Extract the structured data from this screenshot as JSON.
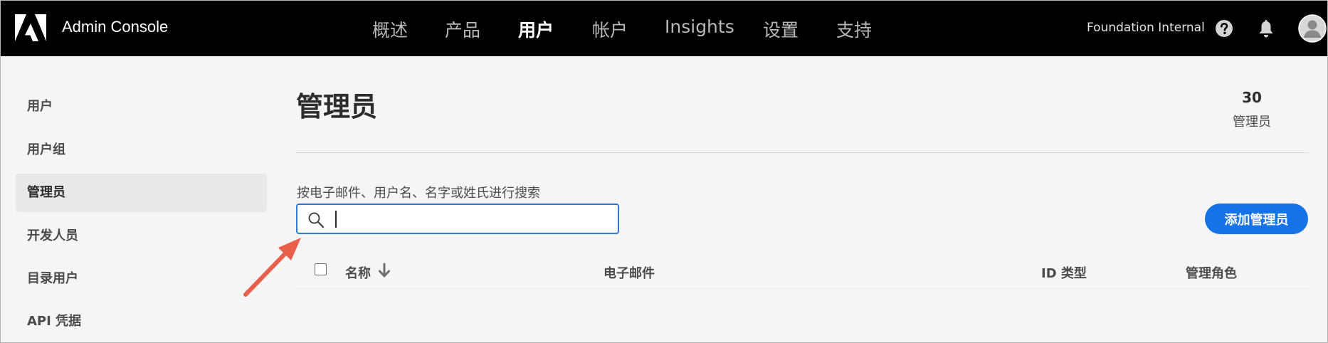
{
  "app": {
    "title": "Admin Console",
    "org_name": "Foundation Internal"
  },
  "nav": {
    "items": [
      {
        "label": "概述"
      },
      {
        "label": "产品"
      },
      {
        "label": "用户",
        "active": true
      },
      {
        "label": "帐户"
      },
      {
        "label": "Insights"
      },
      {
        "label": "设置"
      },
      {
        "label": "支持"
      }
    ]
  },
  "header_icons": [
    "help-icon",
    "bell-icon",
    "avatar-icon"
  ],
  "sidebar": {
    "items": [
      {
        "label": "用户"
      },
      {
        "label": "用户组"
      },
      {
        "label": "管理员",
        "active": true
      },
      {
        "label": "开发人员"
      },
      {
        "label": "目录用户"
      },
      {
        "label": "API 凭据"
      }
    ]
  },
  "main": {
    "title": "管理员",
    "count": {
      "value": "30",
      "label": "管理员"
    },
    "search": {
      "label": "按电子邮件、用户名、名字或姓氏进行搜索",
      "value": "",
      "placeholder": ""
    },
    "add_button_label": "添加管理员",
    "table": {
      "columns": [
        {
          "label": "名称",
          "sorted": "descending"
        },
        {
          "label": "电子邮件"
        },
        {
          "label": "ID 类型"
        },
        {
          "label": "管理角色"
        }
      ],
      "rows": []
    }
  },
  "colors": {
    "topbar_bg": "#000000",
    "accent": "#1473e6",
    "focus_border": "#2d7bd6",
    "annotation_arrow": "#e8604c"
  }
}
